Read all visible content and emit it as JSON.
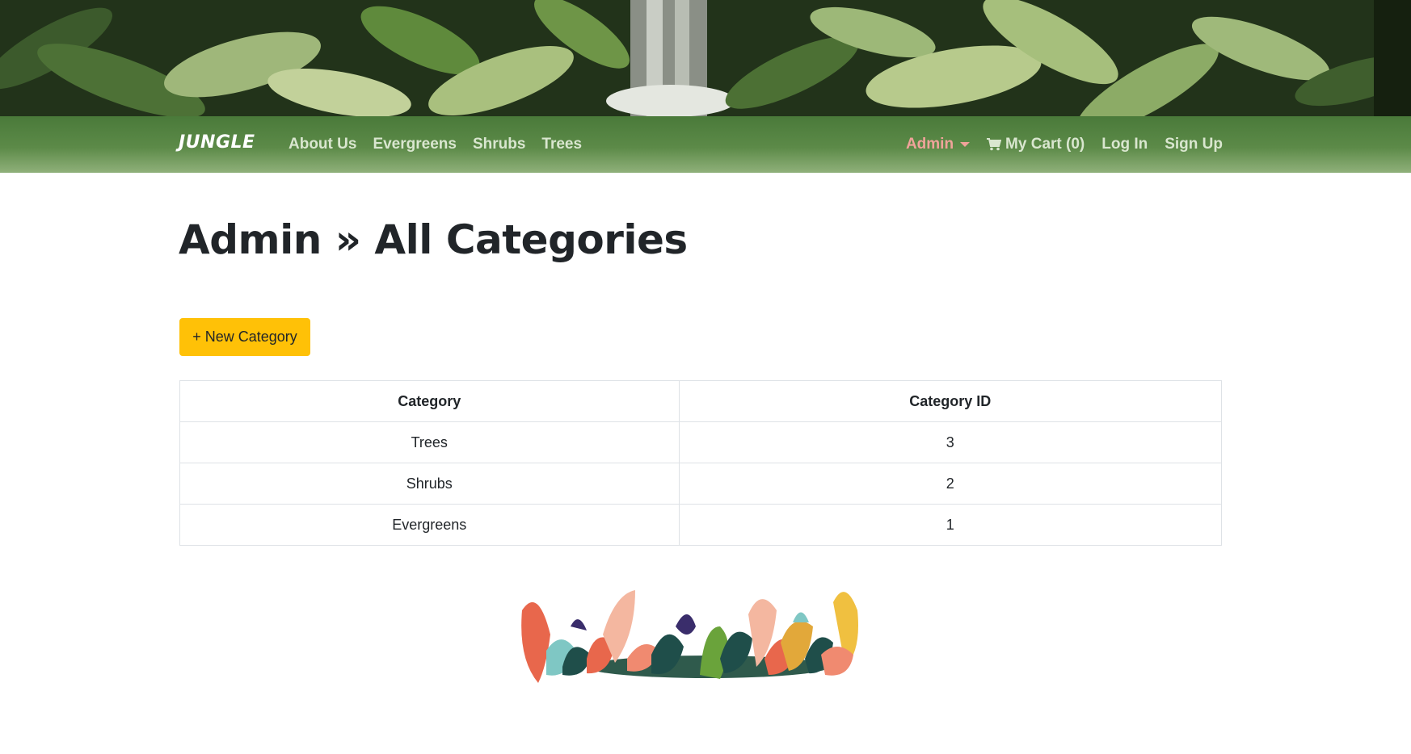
{
  "nav": {
    "brand": "JUNGLE",
    "links": [
      "About Us",
      "Evergreens",
      "Shrubs",
      "Trees"
    ],
    "admin_label": "Admin",
    "cart_label": "My Cart (0)",
    "login_label": "Log In",
    "signup_label": "Sign Up"
  },
  "page": {
    "title": "Admin » All Categories",
    "new_button_label": "+ New Category"
  },
  "table": {
    "headers": [
      "Category",
      "Category ID"
    ],
    "rows": [
      [
        "Trees",
        "3"
      ],
      [
        "Shrubs",
        "2"
      ],
      [
        "Evergreens",
        "1"
      ]
    ]
  },
  "colors": {
    "nav_green": "#5c8a48",
    "admin_accent": "#f0a39a",
    "button_yellow": "#ffc107"
  }
}
